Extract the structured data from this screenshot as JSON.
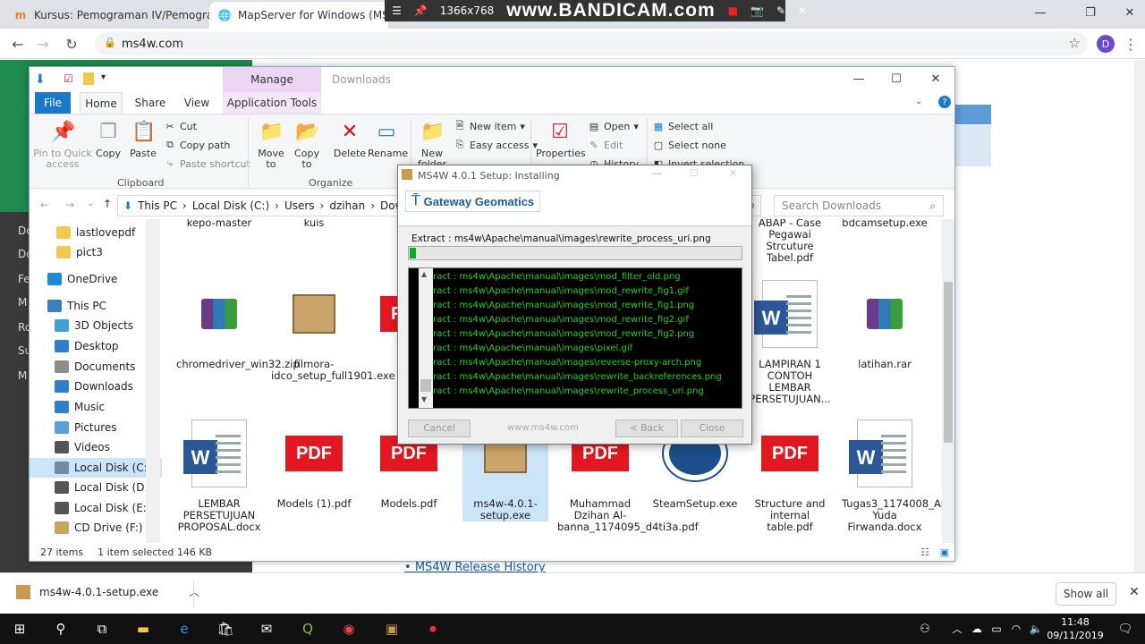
{
  "browser": {
    "tabs": [
      {
        "title": "Kursus: Pemograman IV/Pemogra",
        "active": false
      },
      {
        "title": "MapServer for Windows (MS4W",
        "active": true
      }
    ],
    "url": "ms4w.com",
    "profile_initial": "D"
  },
  "recorder": {
    "resolution": "1366x768",
    "brand": "www.BANDICAM.com"
  },
  "page": {
    "sidebar_items": [
      "Do",
      "Do",
      "Fe",
      "M",
      "Ro",
      "Su",
      "M"
    ],
    "history_link": "MS4W Release History"
  },
  "explorer": {
    "context_tab": "Manage",
    "window_title": "Downloads",
    "ribbon_tabs": {
      "file": "File",
      "home": "Home",
      "share": "Share",
      "view": "View",
      "app_tools": "Application Tools"
    },
    "clipboard": {
      "pin": "Pin to Quick access",
      "copy": "Copy",
      "paste": "Paste",
      "cut": "Cut",
      "copy_path": "Copy path",
      "paste_shortcut": "Paste shortcut",
      "group": "Clipboard"
    },
    "organize": {
      "move_to": "Move to",
      "copy_to": "Copy to",
      "delete": "Delete",
      "rename": "Rename",
      "group": "Organize"
    },
    "new": {
      "new_folder": "New folder",
      "new_item": "New item",
      "easy_access": "Easy access"
    },
    "open": {
      "properties": "Properties",
      "open": "Open",
      "edit": "Edit",
      "history": "History"
    },
    "select": {
      "all": "Select all",
      "none": "Select none",
      "invert": "Invert selection"
    },
    "path": [
      "This PC",
      "Local Disk (C:)",
      "Users",
      "dzihan",
      "Dow"
    ],
    "search_placeholder": "Search Downloads",
    "nav": [
      {
        "label": "lastlovepdf",
        "color": "#f3c94c"
      },
      {
        "label": "pict3",
        "color": "#f3c94c"
      },
      {
        "label": "OneDrive",
        "color": "#1c8ad8"
      },
      {
        "label": "This PC",
        "color": "#3a7fc4"
      },
      {
        "label": "3D Objects",
        "color": "#3fa0d9"
      },
      {
        "label": "Desktop",
        "color": "#2f7fcf"
      },
      {
        "label": "Documents",
        "color": "#8c8c8c"
      },
      {
        "label": "Downloads",
        "color": "#2f7fcf"
      },
      {
        "label": "Music",
        "color": "#2f7fcf"
      },
      {
        "label": "Pictures",
        "color": "#5a9fd6"
      },
      {
        "label": "Videos",
        "color": "#555"
      },
      {
        "label": "Local Disk (C:)",
        "color": "#6e8ca8"
      },
      {
        "label": "Local Disk (D:)",
        "color": "#555"
      },
      {
        "label": "Local Disk (E:)",
        "color": "#555"
      },
      {
        "label": "CD Drive (F:)",
        "color": "#c9a65a"
      }
    ],
    "files_top_row": [
      "kepo-master",
      "kuis",
      "ABAP - Case Pegawai Strcuture Tabel.pdf",
      "bdcamsetup.exe"
    ],
    "files": [
      {
        "name": "chromedriver_win32.zip",
        "kind": "rar"
      },
      {
        "name": "filmora-idco_setup_full1901.exe",
        "kind": "exe"
      },
      {
        "name": "Fo",
        "kind": "pdf"
      },
      {
        "name": "LAMPIRAN 1 CONTOH LEMBAR PERSETUJUAN...",
        "kind": "doc"
      },
      {
        "name": "latihan.rar",
        "kind": "rar"
      },
      {
        "name": "LEMBAR PERSETUJUAN PROPOSAL.docx",
        "kind": "doc"
      },
      {
        "name": "Models (1).pdf",
        "kind": "pdf"
      },
      {
        "name": "Models.pdf",
        "kind": "pdf"
      },
      {
        "name": "ms4w-4.0.1-setup.exe",
        "kind": "exe",
        "selected": true
      },
      {
        "name": "Muhammad Dzihan Al-banna_1174095_d4ti3a.pdf",
        "kind": "pdf"
      },
      {
        "name": "SteamSetup.exe",
        "kind": "steam"
      },
      {
        "name": "Structure and internal table.pdf",
        "kind": "pdf"
      },
      {
        "name": "Tugas3_1174008_Arjun Yuda Firwanda.docx",
        "kind": "doc"
      }
    ],
    "pdf_label": "PDF",
    "word_label": "W",
    "status": {
      "count": "27 items",
      "selected": "1 item selected  146 KB"
    }
  },
  "installer": {
    "title": "MS4W 4.0.1 Setup: Installing",
    "logo": "Gateway Geomatics",
    "current": "Extract : ms4w\\Apache\\manual\\images\\rewrite_process_uri.png",
    "progress": 0.02,
    "log": [
      "Extract : ms4w\\Apache\\manual\\images\\mod_filter_old.png",
      "Extract : ms4w\\Apache\\manual\\images\\mod_rewrite_fig1.gif",
      "Extract : ms4w\\Apache\\manual\\images\\mod_rewrite_fig1.png",
      "Extract : ms4w\\Apache\\manual\\images\\mod_rewrite_fig2.gif",
      "Extract : ms4w\\Apache\\manual\\images\\mod_rewrite_fig2.png",
      "Extract : ms4w\\Apache\\manual\\images\\pixel.gif",
      "Extract : ms4w\\Apache\\manual\\images\\reverse-proxy-arch.png",
      "Extract : ms4w\\Apache\\manual\\images\\rewrite_backreferences.png",
      "Extract : ms4w\\Apache\\manual\\images\\rewrite_process_uri.png"
    ],
    "cancel": "Cancel",
    "site": "www.ms4w.com",
    "back": "< Back",
    "close": "Close"
  },
  "download_bar": {
    "file": "ms4w-4.0.1-setup.exe",
    "show_all": "Show all"
  },
  "taskbar": {
    "time": "11:48",
    "date": "09/11/2019"
  }
}
